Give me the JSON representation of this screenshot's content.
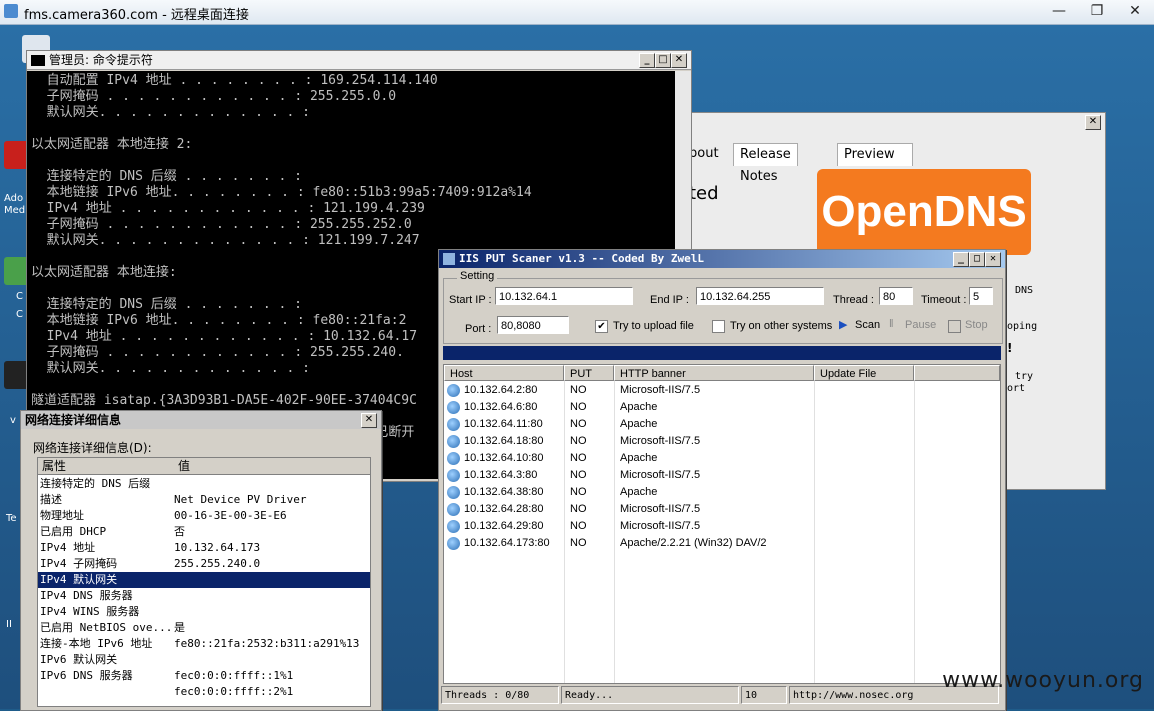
{
  "rdp": {
    "title": "fms.camera360.com - 远程桌面连接",
    "min": "—",
    "max": "❐",
    "close": "✕"
  },
  "desktop_labels": [
    "Ado",
    "Med",
    "C",
    "C",
    "v",
    "Te",
    "II"
  ],
  "cmd": {
    "title": "管理员: 命令提示符",
    "lines": [
      "  自动配置 IPv4 地址 . . . . . . . . : 169.254.114.140",
      "  子网掩码 . . . . . . . . . . . . : 255.255.0.0",
      "  默认网关. . . . . . . . . . . . . :",
      "",
      "以太网适配器 本地连接 2:",
      "",
      "  连接特定的 DNS 后缀 . . . . . . . :",
      "  本地链接 IPv6 地址. . . . . . . . : fe80::51b3:99a5:7409:912a%14",
      "  IPv4 地址 . . . . . . . . . . . . : 121.199.4.239",
      "  子网掩码 . . . . . . . . . . . . : 255.255.252.0",
      "  默认网关. . . . . . . . . . . . . : 121.199.7.247",
      "",
      "以太网适配器 本地连接:",
      "",
      "  连接特定的 DNS 后缀 . . . . . . . :",
      "  本地链接 IPv6 地址. . . . . . . . : fe80::21fa:2",
      "  IPv4 地址 . . . . . . . . . . . . : 10.132.64.17",
      "  子网掩码 . . . . . . . . . . . . : 255.255.240.",
      "  默认网关. . . . . . . . . . . . . :",
      "",
      "隧道适配器 isatap.{3A3D93B1-DA5E-402F-90EE-37404C9C",
      "",
      "                                            已断开"
    ]
  },
  "opendns": {
    "tabs": [
      "bout",
      "Release Notes",
      "Preview Feedback"
    ],
    "logo": "OpenDNS",
    "partial_text": "ted",
    "side_text": [
      "DNS",
      "oping",
      "!",
      "try",
      "ort"
    ],
    "close": "✕"
  },
  "netdetails": {
    "title": "网络连接详细信息",
    "label": "网络连接详细信息(D):",
    "headers": [
      "属性",
      "值"
    ],
    "rows": [
      [
        "连接特定的 DNS 后缀",
        ""
      ],
      [
        "描述",
        "Net Device PV Driver"
      ],
      [
        "物理地址",
        "00-16-3E-00-3E-E6"
      ],
      [
        "已启用 DHCP",
        "否"
      ],
      [
        "IPv4 地址",
        "10.132.64.173"
      ],
      [
        "IPv4 子网掩码",
        "255.255.240.0"
      ],
      [
        "IPv4 默认网关",
        ""
      ],
      [
        "IPv4 DNS 服务器",
        ""
      ],
      [
        "IPv4 WINS 服务器",
        ""
      ],
      [
        "已启用 NetBIOS ove...",
        "是"
      ],
      [
        "连接-本地 IPv6 地址",
        "fe80::21fa:2532:b311:a291%13"
      ],
      [
        "IPv6 默认网关",
        ""
      ],
      [
        "IPv6 DNS 服务器",
        "fec0:0:0:ffff::1%1"
      ],
      [
        "",
        "fec0:0:0:ffff::2%1"
      ]
    ],
    "selected_row": 6
  },
  "iis": {
    "title": "IIS PUT Scaner v1.3 -- Coded By ZwelL",
    "setting_label": "Setting",
    "start_ip_label": "Start IP :",
    "start_ip": "10.132.64.1",
    "end_ip_label": "End IP :",
    "end_ip": "10.132.64.255",
    "thread_label": "Thread :",
    "thread": "80",
    "timeout_label": "Timeout :",
    "timeout": "5",
    "port_label": "Port :",
    "port": "80,8080",
    "upload_label": "Try to upload file",
    "upload_checked": "✔",
    "other_label": "Try on other systems",
    "scan_label": "Scan",
    "pause_label": "Pause",
    "stop_label": "Stop",
    "columns": [
      "Host",
      "PUT",
      "HTTP banner",
      "Update File"
    ],
    "rows": [
      [
        "10.132.64.2:80",
        "NO",
        "Microsoft-IIS/7.5",
        ""
      ],
      [
        "10.132.64.6:80",
        "NO",
        "Apache",
        ""
      ],
      [
        "10.132.64.11:80",
        "NO",
        "Apache",
        ""
      ],
      [
        "10.132.64.18:80",
        "NO",
        "Microsoft-IIS/7.5",
        ""
      ],
      [
        "10.132.64.10:80",
        "NO",
        "Apache",
        ""
      ],
      [
        "10.132.64.3:80",
        "NO",
        "Microsoft-IIS/7.5",
        ""
      ],
      [
        "10.132.64.38:80",
        "NO",
        "Apache",
        ""
      ],
      [
        "10.132.64.28:80",
        "NO",
        "Microsoft-IIS/7.5",
        ""
      ],
      [
        "10.132.64.29:80",
        "NO",
        "Microsoft-IIS/7.5",
        ""
      ],
      [
        "10.132.64.173:80",
        "NO",
        "Apache/2.2.21 (Win32) DAV/2",
        ""
      ]
    ],
    "status": [
      "Threads : 0/80",
      "Ready...",
      "10",
      "http://www.nosec.org"
    ]
  },
  "watermark": "www.wooyun.org"
}
